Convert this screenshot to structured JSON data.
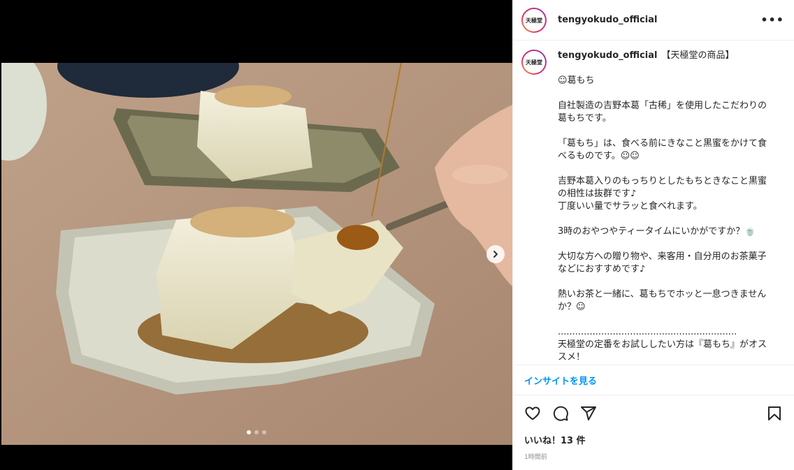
{
  "account": {
    "username": "tengyokudo_official",
    "avatar_text": "天極堂"
  },
  "header": {
    "more_label": "•••"
  },
  "caption": {
    "username": "tengyokudo_official",
    "title": "【天極堂の商品】",
    "lines": [
      "",
      "☺葛もち",
      "",
      "自社製造の吉野本葛「古稀」を使用したこだわりの葛もちです。",
      "",
      "「葛もち」は、食べる前にきなこと黒蜜をかけて食べるものです。☺☺",
      "",
      "吉野本葛入りのもっちりとしたもちときなこと黒蜜の相性は抜群です♪",
      "丁度いい量でサラッと食べれます。",
      "",
      "3時のおやつやティータイムにいかがですか？🍵",
      "",
      "大切な方への贈り物や、来客用・自分用のお茶菓子などにおすすめです♪",
      "",
      "熱いお茶と一緒に、葛もちでホッと一息つきませんか？☺",
      "",
      "..............................................................",
      "天極堂の定番をお試ししたい方は『葛もち』がオススメ！"
    ]
  },
  "insights_label": "インサイトを見る",
  "likes_text": "いいね！13 件",
  "timestamp": "1時間前",
  "carousel": {
    "slide_count": 3,
    "active_index": 0
  },
  "colors": {
    "link": "#0095f6",
    "border": "#efefef",
    "muted": "#8e8e8e"
  }
}
